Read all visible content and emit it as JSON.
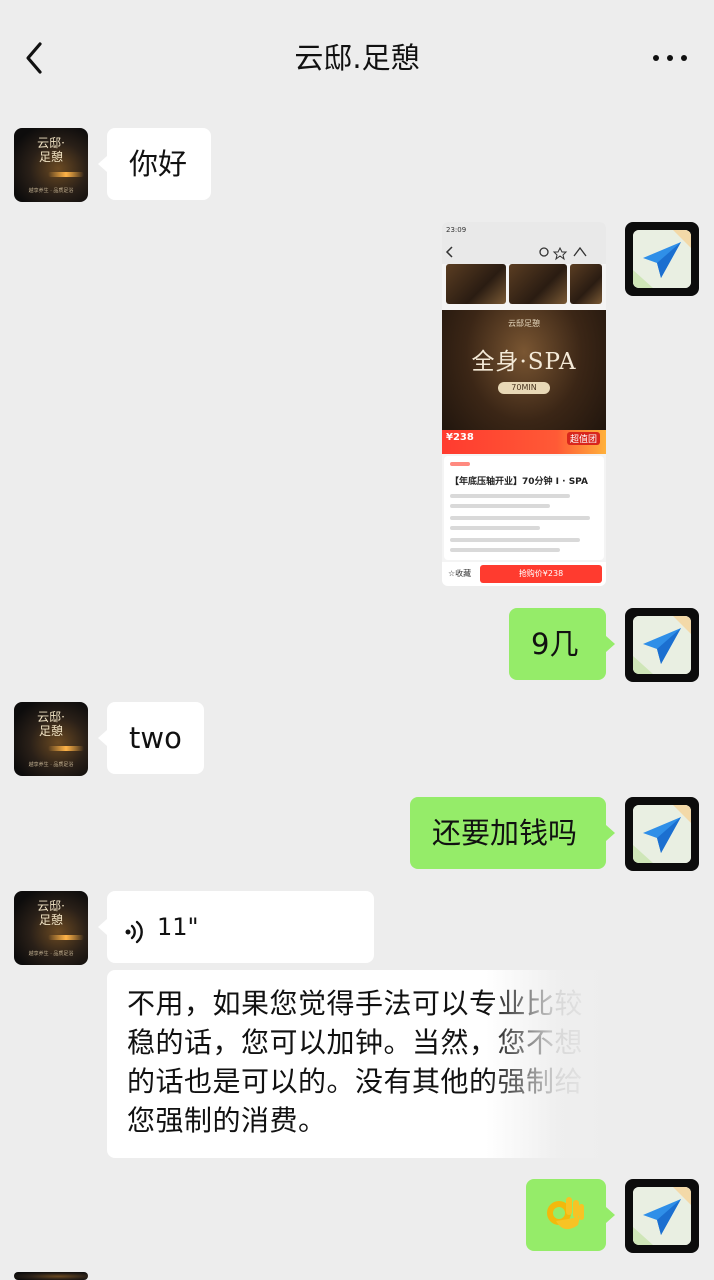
{
  "header": {
    "title": "云邸.足憩",
    "back_icon": "chevron-left-icon",
    "more_icon": "more-dots-icon"
  },
  "shop_avatar": {
    "name": "云邸·足憩",
    "subtitle": "越享养生 · 品质足浴"
  },
  "thumbnail": {
    "status_time": "23:09",
    "logo": "云邸足憩",
    "hero_title": "全身·SPA",
    "hero_duration": "70MIN",
    "price": "¥238",
    "badge": "超值团",
    "deal_title": "【年底压轴开业】70分钟 I · SPA",
    "favorite": "☆收藏",
    "buy_button": "抢购价¥238"
  },
  "messages": [
    {
      "side": "in",
      "type": "text",
      "text": "你好"
    },
    {
      "side": "out",
      "type": "image",
      "text": ""
    },
    {
      "side": "out",
      "type": "text",
      "text": "9几"
    },
    {
      "side": "in",
      "type": "text",
      "text": "two"
    },
    {
      "side": "out",
      "type": "text",
      "text": "还要加钱吗"
    },
    {
      "side": "in",
      "type": "voice",
      "text": "11\"",
      "icon": "voice-waves-icon"
    },
    {
      "side": "in",
      "type": "transcription",
      "text": "不用，如果您觉得手法可以专业比较稳的话，您可以加钟。当然，您不想的话也是可以的。没有其他的强制给您强制的消费。"
    },
    {
      "side": "out",
      "type": "emoji",
      "icon": "ok-hand-icon"
    }
  ],
  "colors": {
    "background": "#ededed",
    "bubble_in": "#ffffff",
    "bubble_out": "#95ec69",
    "thumbnail_accent": "#ff3b2f"
  }
}
